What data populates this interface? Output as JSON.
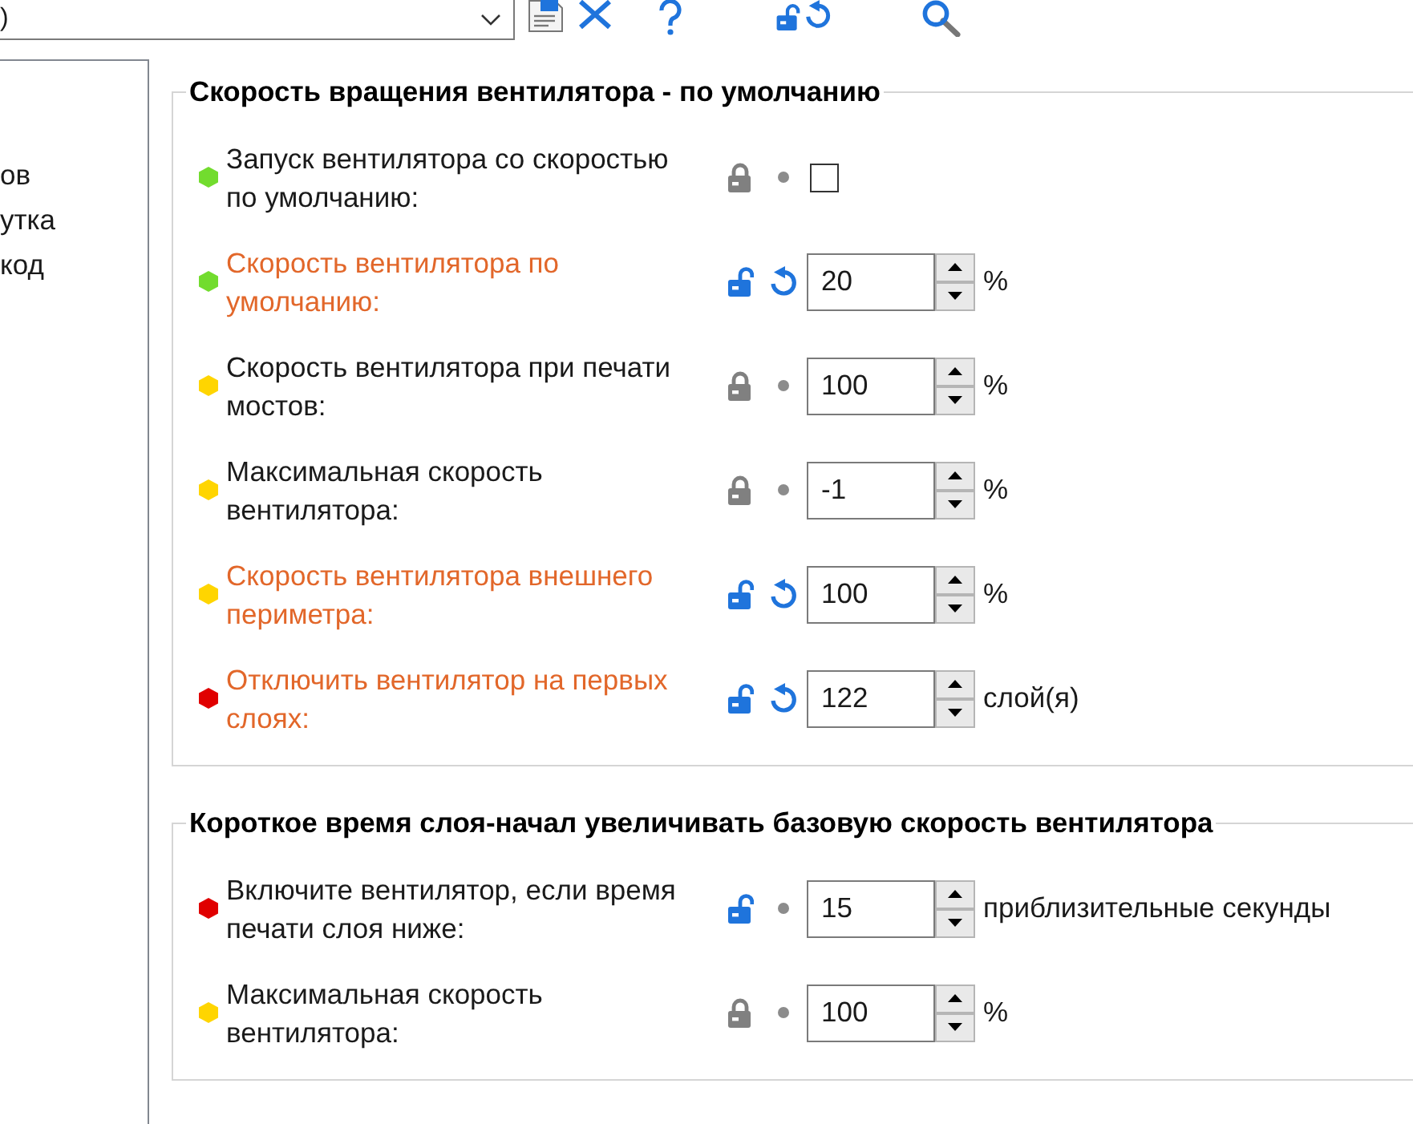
{
  "preset_combo": {
    "value": ")"
  },
  "sidebar": {
    "items": [
      {
        "label": "ов"
      },
      {
        "label": "утка"
      },
      {
        "label": "код"
      }
    ]
  },
  "groups": [
    {
      "title": "Скорость вращения вентилятора - по умолчанию",
      "settings": [
        {
          "kind": "checkbox",
          "label": "Запуск вентилятора со скоростью по умолчанию:",
          "color": "#72dc2e",
          "locked": true,
          "modified": false,
          "checked": false
        },
        {
          "kind": "spin",
          "label": "Скорость вентилятора по умолчанию:",
          "color": "#72dc2e",
          "locked": false,
          "modified": true,
          "value": "20",
          "unit": "%"
        },
        {
          "kind": "spin",
          "label": "Скорость вентилятора при печати мостов:",
          "color": "#ffd500",
          "locked": true,
          "modified": false,
          "value": "100",
          "unit": "%"
        },
        {
          "kind": "spin",
          "label": "Максимальная скорость вентилятора:",
          "color": "#ffd500",
          "locked": true,
          "modified": false,
          "value": "-1",
          "unit": "%"
        },
        {
          "kind": "spin",
          "label": "Скорость вентилятора внешнего периметра:",
          "color": "#ffd500",
          "locked": false,
          "modified": true,
          "value": "100",
          "unit": "%"
        },
        {
          "kind": "spin",
          "label": "Отключить вентилятор на первых слоях:",
          "color": "#e00000",
          "locked": false,
          "modified": true,
          "value": "122",
          "unit": "слой(я)"
        }
      ]
    },
    {
      "title": "Короткое время слоя-начал увеличивать базовую скорость вентилятора",
      "settings": [
        {
          "kind": "spin",
          "label": "Включите вентилятор, если время печати слоя ниже:",
          "color": "#e00000",
          "locked": false,
          "modified": false,
          "value": "15",
          "unit": "приблизительные секунды"
        },
        {
          "kind": "spin",
          "label": "Максимальная скорость вентилятора:",
          "color": "#ffd500",
          "locked": true,
          "modified": false,
          "value": "100",
          "unit": "%"
        }
      ]
    }
  ]
}
